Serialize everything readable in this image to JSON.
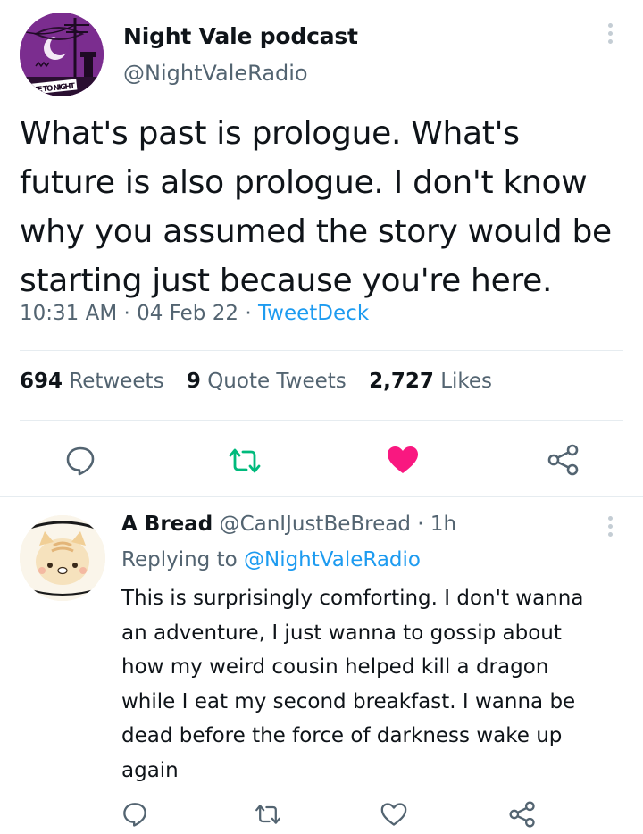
{
  "main_tweet": {
    "author_name": "Night Vale podcast",
    "author_handle": "@NightValeRadio",
    "avatar_text": "COME TO NIGHT VALE",
    "text_lines": [
      "What's past is prologue. What's",
      "future is also prologue. I don't know",
      "why you assumed the story would be",
      "starting just because you're here."
    ],
    "time": "10:31 AM",
    "date": "04 Feb 22",
    "separator": "·",
    "source": "TweetDeck",
    "retweets_count": "694",
    "retweets_label": "Retweets",
    "quotes_count": "9",
    "quotes_label": "Quote Tweets",
    "likes_count": "2,727",
    "likes_label": "Likes",
    "liked": true
  },
  "reply": {
    "author_name": "A Bread",
    "author_handle": "@CanIJustBeBread",
    "separator": "·",
    "time_ago": "1h",
    "replying_prefix": "Replying to",
    "replying_to": "@NightValeRadio",
    "text_lines": [
      "This is surprisingly comforting. I don't wanna",
      "an adventure, I just wanna to gossip about",
      "how my weird cousin helped kill a dragon",
      "while I eat my second breakfast. I wanna be",
      "dead before the force of darkness wake up",
      "again"
    ],
    "liked": false
  },
  "icons": {
    "reply": "speech-bubble-icon",
    "retweet": "retweet-icon",
    "like": "heart-icon",
    "share": "share-icon",
    "more": "vertical-ellipsis-icon"
  },
  "colors": {
    "text": "#0f1419",
    "secondary": "#536471",
    "link": "#1d9bf0",
    "retweet": "#00ba7c",
    "like": "#f91880",
    "divider": "#e6ecf0"
  }
}
